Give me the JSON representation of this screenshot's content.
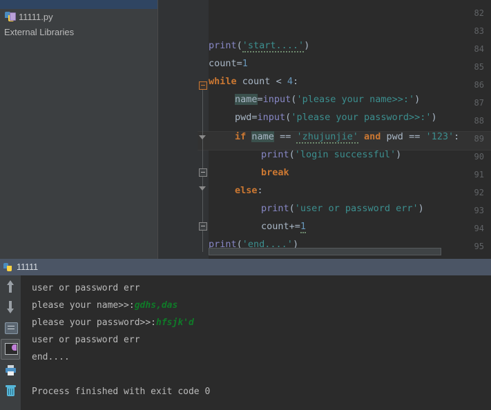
{
  "window": {
    "theme_bg": "#3c3f41",
    "editor_bg": "#2b2b2b",
    "accent_selected": "#2f4562",
    "console_tab_bg": "#4b5565"
  },
  "project_tree": {
    "partial_top_row_text": "",
    "items": [
      {
        "label": "11111.py",
        "icon": "python-file-icon",
        "selected": false
      },
      {
        "label": "External Libraries",
        "icon": "none",
        "selected": false
      }
    ]
  },
  "editor": {
    "first_visible_line": 82,
    "current_line": 89,
    "lines": [
      {
        "num": "82",
        "text": ""
      },
      {
        "num": "83",
        "text": ""
      },
      {
        "num": "84",
        "text": "    print('start....')"
      },
      {
        "num": "85",
        "text": "    count=1"
      },
      {
        "num": "86",
        "text": "    while count < 4:"
      },
      {
        "num": "87",
        "text": "        name=input('please your name>>:')"
      },
      {
        "num": "88",
        "text": "        pwd=input('please your password>>:')"
      },
      {
        "num": "89",
        "text": "        if name == 'zhujunjie' and pwd == '123':"
      },
      {
        "num": "90",
        "text": "            print('login successful')"
      },
      {
        "num": "91",
        "text": "            break"
      },
      {
        "num": "92",
        "text": "        else:"
      },
      {
        "num": "93",
        "text": "            print('user or password err')"
      },
      {
        "num": "94",
        "text": "            count+=1"
      },
      {
        "num": "95",
        "text": "    print('end....')"
      }
    ],
    "tokens": {
      "keywords": [
        "while",
        "if",
        "and",
        "break",
        "else"
      ],
      "builtins": [
        "print",
        "input"
      ],
      "strings": [
        "'start....'",
        "'please your name>>:'",
        "'please your password>>:'",
        "'zhujunjie'",
        "'123'",
        "'login successful'",
        "'user or password err'",
        "'end....'"
      ],
      "numbers": [
        "1",
        "4"
      ],
      "keyword_color": "#cc7832",
      "string_color": "#3c8f8f",
      "builtin_color": "#8888c6",
      "number_color": "#6897bb",
      "default_color": "#a9b7c6",
      "line_number_color": "#606366"
    }
  },
  "console": {
    "tab_label": "11111",
    "tab_icon": "python-run-icon",
    "toolbar": [
      {
        "name": "up-arrow-icon",
        "title": "Up the Stack Trace"
      },
      {
        "name": "down-arrow-icon",
        "title": "Down the Stack Trace"
      },
      {
        "name": "soft-wrap-icon",
        "title": "Use Soft Wraps"
      },
      {
        "name": "scroll-to-end-icon",
        "title": "Scroll to End",
        "selected": true
      },
      {
        "name": "print-icon",
        "title": "Print"
      },
      {
        "name": "trash-icon",
        "title": "Clear All"
      }
    ],
    "output": [
      {
        "text": "user or password err",
        "type": "out"
      },
      {
        "prompt": "please your name>>:",
        "input": "gdhs,das",
        "type": "prompt"
      },
      {
        "prompt": "please your password>>:",
        "input": "hfsjk'd",
        "type": "prompt"
      },
      {
        "text": "user or password err",
        "type": "out"
      },
      {
        "text": "end....",
        "type": "out"
      },
      {
        "text": "",
        "type": "out"
      },
      {
        "text": "Process finished with exit code 0",
        "type": "out"
      }
    ],
    "user_input_color": "#0f7b28",
    "output_color": "#bbbbbb"
  }
}
